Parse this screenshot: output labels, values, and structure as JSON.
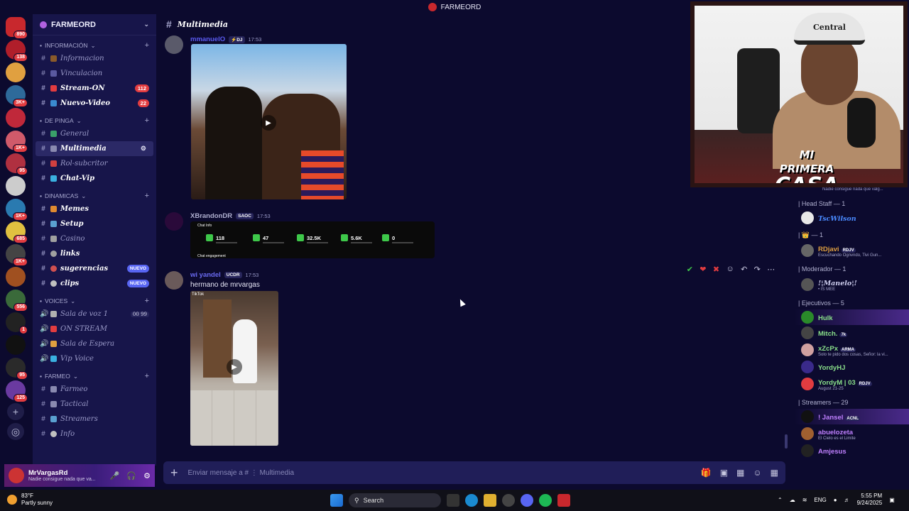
{
  "window": {
    "title": "FARMEORD"
  },
  "servers": [
    {
      "badge": "890",
      "color": "#c8282d"
    },
    {
      "badge": "138",
      "color": "#b01e2a"
    },
    {
      "badge": "",
      "color": "#e0a040"
    },
    {
      "badge": "3K+",
      "color": "#2e6a9a"
    },
    {
      "badge": "",
      "color": "#c0283a"
    },
    {
      "badge": "1K+",
      "color": "#d05a6a"
    },
    {
      "badge": "95",
      "color": "#b03040"
    },
    {
      "badge": "",
      "color": "#cccccc"
    },
    {
      "badge": "1K+",
      "color": "#2a7ab0"
    },
    {
      "badge": "685",
      "color": "#e0c040"
    },
    {
      "badge": "1K+",
      "color": "#444444"
    },
    {
      "badge": "",
      "color": "#a05020"
    },
    {
      "badge": "556",
      "color": "#3a6a3a"
    },
    {
      "badge": "1",
      "color": "#222222"
    },
    {
      "badge": "",
      "color": "#111111"
    },
    {
      "badge": "95",
      "color": "#2a2a2a"
    },
    {
      "badge": "125",
      "color": "#6a3aa0"
    }
  ],
  "guild": {
    "name": "FARMEORD"
  },
  "categories": [
    {
      "name": "INFORMACIÓN",
      "channels": [
        {
          "name": "Informacion",
          "emoji": "#8a5a2a",
          "badge": ""
        },
        {
          "name": "Vinculacion",
          "emoji": "#5a5aa0",
          "badge": ""
        },
        {
          "name": "Stream-ON",
          "emoji": "#e23c40",
          "badge": "112",
          "bold": true
        },
        {
          "name": "Nuevo-Video",
          "emoji": "#3a8ad0",
          "badge": "22",
          "bold": true
        }
      ]
    },
    {
      "name": "DE PINGA",
      "channels": [
        {
          "name": "General",
          "emoji": "#3aa06a",
          "badge": ""
        },
        {
          "name": "Multimedia",
          "emoji": "#8a8ab0",
          "badge": "",
          "active": true
        },
        {
          "name": "Rol-subcritor",
          "emoji": "#d04040",
          "badge": ""
        },
        {
          "name": "Chat-Vip",
          "emoji": "#3ab0e0",
          "badge": "",
          "bold": true
        }
      ]
    },
    {
      "name": "DINAMICAS",
      "channels": [
        {
          "name": "Memes",
          "emoji": "#e08a30",
          "badge": "",
          "bold": true
        },
        {
          "name": "Setup",
          "emoji": "#5aa0d0",
          "badge": "",
          "bold": true
        },
        {
          "name": "Casino",
          "emoji": "#a0a0a0",
          "badge": ""
        },
        {
          "name": "links",
          "emoji": "#a0a0a0",
          "badge": "",
          "bold": true,
          "plain": true
        },
        {
          "name": "sugerencias",
          "emoji": "#d05050",
          "nuevo": "NUEVO",
          "bold": true,
          "plain": true
        },
        {
          "name": "clips",
          "emoji": "#c0c0c0",
          "nuevo": "NUEVO",
          "bold": true,
          "plain": true
        }
      ]
    },
    {
      "name": "VOICES",
      "voice": true,
      "channels": [
        {
          "name": "Sala de voz 1",
          "emoji": "#b0b0b0",
          "vc": "00",
          "vc2": "99"
        },
        {
          "name": "ON STREAM",
          "emoji": "#e23c40"
        },
        {
          "name": "Sala de Espera",
          "emoji": "#e0a040"
        },
        {
          "name": "Vip Voice",
          "emoji": "#3ab0e0"
        }
      ]
    },
    {
      "name": "FARMEO",
      "channels": [
        {
          "name": "Farmeo",
          "emoji": "#8a8ab0"
        },
        {
          "name": "Tactical",
          "emoji": "#8a8ab0"
        },
        {
          "name": "Streamers",
          "emoji": "#5aa0d0"
        },
        {
          "name": "Info",
          "emoji": "#c0c0c0",
          "plain": true
        }
      ]
    }
  ],
  "user": {
    "name": "MrVargasRd",
    "status": "Nadie consigue nada que va..."
  },
  "chat": {
    "channel": "Multimedia",
    "placeholder": "Enviar mensaje a # ⋮ Multimedia",
    "messages": [
      {
        "author": "mmanuelO",
        "tag": "⚡DJ",
        "time": "17:53",
        "color": "#5a5af0"
      },
      {
        "author": "XBrandonDR",
        "tag": "SAOC",
        "time": "17:53",
        "color": "#b0b0d0"
      },
      {
        "author": "wi yandel",
        "tag": "UCDR",
        "time": "17:53",
        "text": "hermano de mrvargas",
        "color": "#6a6af0"
      }
    ],
    "embed": {
      "label_top": "Chat Info",
      "label_bottom": "Chat engagement",
      "stats": [
        "118",
        "47",
        "32.5K",
        "5.6K",
        "0"
      ]
    },
    "tiktok_label": "TikTok"
  },
  "webcam": {
    "cap_text": "Central",
    "brand_line1": "MI PRIMERA",
    "brand_line2": "CASA"
  },
  "members": {
    "hint": "Nadie consigue nada que valg...",
    "sections": [
      {
        "title": "| Head Staff — 1",
        "members": [
          {
            "name": "TscWilson",
            "color": "#4a8aff",
            "avatar": "#e8e8e8",
            "italic": true
          }
        ]
      },
      {
        "title": "| 👑 — 1",
        "members": [
          {
            "name": "RDjavi",
            "tag": "RDJV",
            "status": "Escuchando Ognvndo, Tivi Gun...",
            "color": "#e0a040",
            "avatar": "#666666"
          }
        ]
      },
      {
        "title": "| Moderador — 1",
        "members": [
          {
            "name": "!¦Manelo¦!",
            "status": "• IS MEE",
            "color": "#d0d0f0",
            "avatar": "#555555",
            "italic": true
          }
        ]
      },
      {
        "title": "| Ejecutivos — 5",
        "members": [
          {
            "name": "Hulk",
            "color": "#8ae08a",
            "avatar": "#2a8a2a",
            "highlight": true
          },
          {
            "name": "Mitch.",
            "tag": "7k",
            "color": "#8ae08a",
            "avatar": "#444444"
          },
          {
            "name": "xZcPx",
            "tag": "ARMA",
            "status": "Solo te pido dos cosas, Señor: la vi...",
            "color": "#8ae08a",
            "avatar": "#d0a0a0"
          },
          {
            "name": "YordyHJ",
            "color": "#8ae08a",
            "avatar": "#3a2a8a"
          },
          {
            "name": "YordyM | 03",
            "tag": "RDJV",
            "status": "August 21-25",
            "color": "#8ae08a",
            "avatar": "#e23c40"
          }
        ]
      },
      {
        "title": "| Streamers — 29",
        "members": [
          {
            "name": "! Jansel",
            "tag": "ACNL",
            "color": "#c080ff",
            "avatar": "#111111",
            "highlight": true
          },
          {
            "name": "abuelozeta",
            "status": "El Cielo es el Limite",
            "color": "#c080ff",
            "avatar": "#a06030"
          },
          {
            "name": "Amjesus",
            "color": "#c080ff",
            "avatar": "#222222"
          }
        ]
      }
    ]
  },
  "taskbar": {
    "temp": "83°F",
    "weather": "Partly sunny",
    "search": "Search",
    "lang": "ENG",
    "time": "5:55 PM",
    "date": "9/24/2025"
  },
  "colors": {
    "background": "#0c0a2e",
    "sidebar": "#17154a",
    "accent": "#5865f2",
    "badge": "#e23c40"
  }
}
